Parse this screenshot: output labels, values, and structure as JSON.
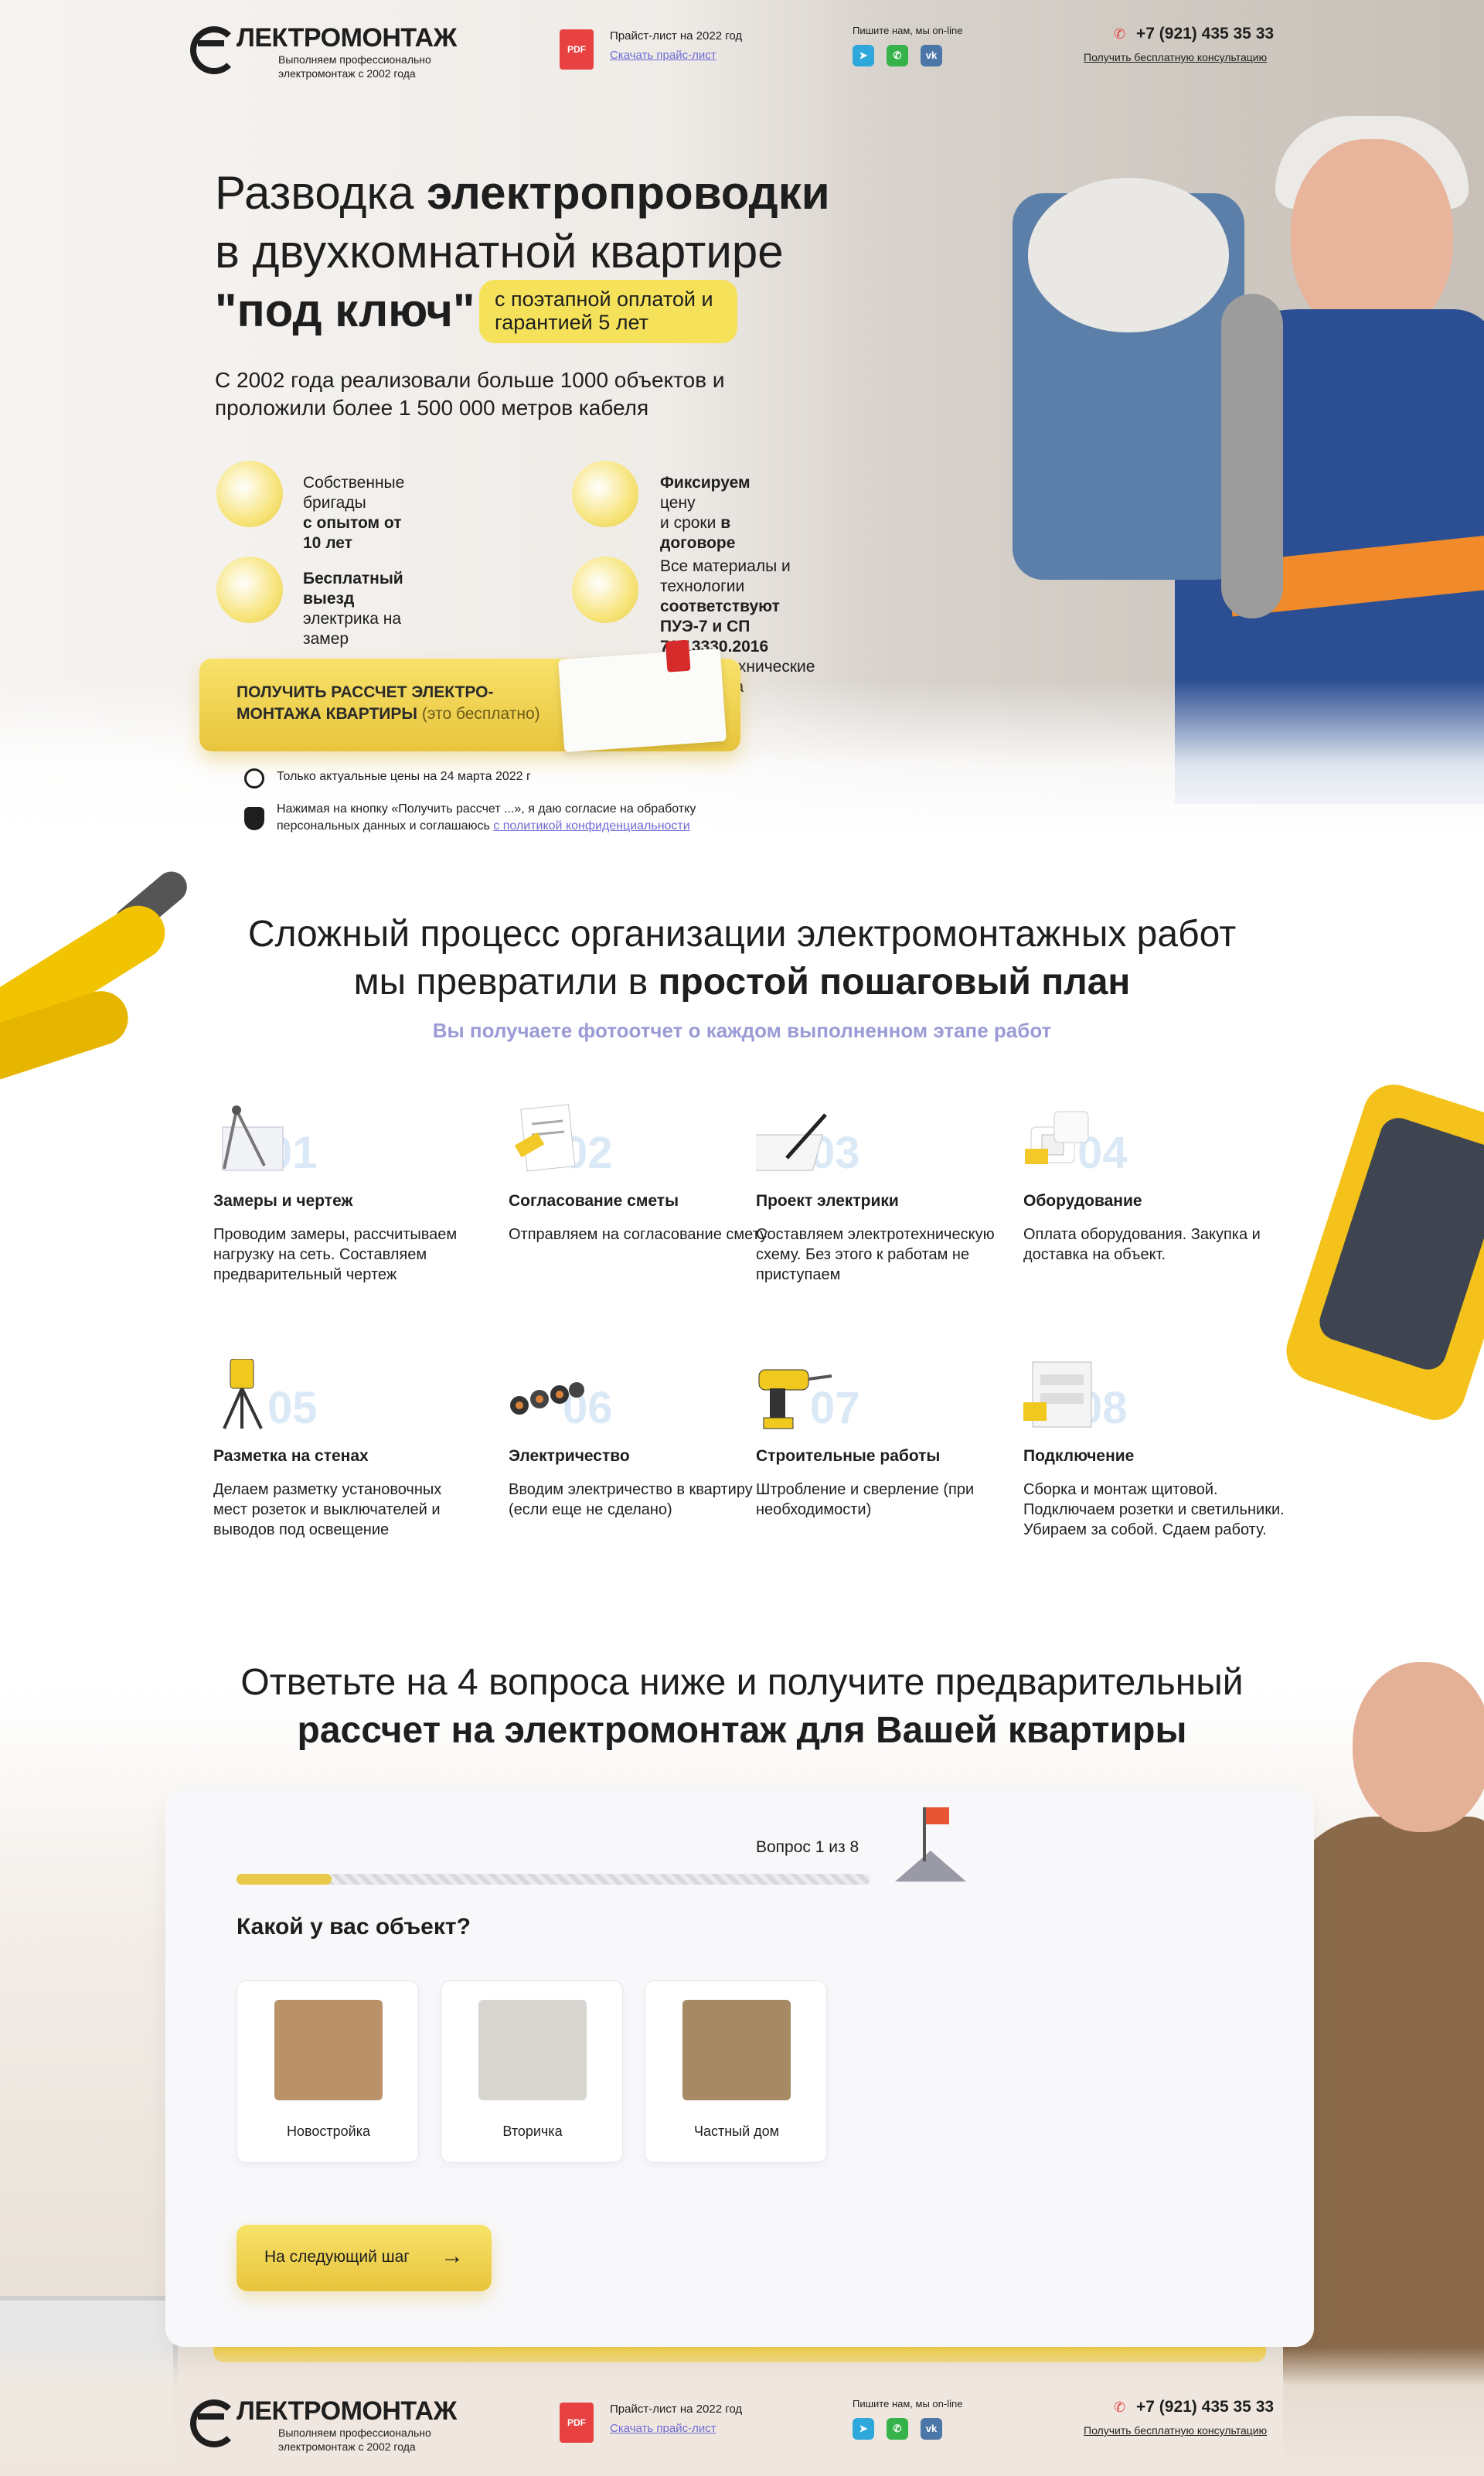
{
  "header": {
    "logo_word": "ЛЕКТРОМОНТАЖ",
    "logo_sub": "Выполняем профессионально электромонтаж с 2002 года",
    "pdf_badge": "PDF",
    "price_title": "Прайст-лист на 2022 год",
    "price_link": "Скачать прайс-лист",
    "write": "Пишите нам, мы on-line",
    "socials": [
      "tg",
      "wa",
      "vk"
    ],
    "phone": "+7 (921) 435 35 33",
    "consult": "Получить бесплатную консультацию"
  },
  "hero": {
    "title_l1_a": "Разводка ",
    "title_l1_b": "электропроводки",
    "title_l2": "в двухкомнатной квартире",
    "title_l3": "\"под ключ\"",
    "badge": "с поэтапной оплатой и гарантией 5 лет",
    "subtitle": "С 2002 года реализовали больше 1000 объектов и проложили более 1 500 000 метров кабеля",
    "features": [
      {
        "a": "Собственные бригады",
        "b": "с опытом от 10 лет",
        "icon": "helmet-icon"
      },
      {
        "a": "Фиксируем",
        "a2": " цену",
        "b": "и сроки ",
        "b2": "в договоре",
        "icon": "contract-icon"
      },
      {
        "a": "Бесплатный выезд",
        "b": "электрика на замер",
        "icon": "van-icon"
      },
      {
        "a": "Все материалы и технологии",
        "b": "соответствуют ПУЭ-7 и СП 76.13330.2016",
        "c": "Электротехнические устройства",
        "icon": "documents-icon"
      }
    ],
    "cta_line1": "ПОЛУЧИТЬ РАССЧЕТ ЭЛЕКТРО-",
    "cta_line2": "МОНТАЖА КВАРТИРЫ",
    "cta_free": "(это бесплатно)",
    "note1": "Только актуальные цены на 24 марта 2022 г",
    "note2": "Нажимая на кнопку «Получить рассчет ...», я даю согласие на обработку персональных данных и соглашаюсь ",
    "note2_link": "с политикой конфиденциальности"
  },
  "steps_section": {
    "title_l1": "Сложный процесс организации электромонтажных работ",
    "title_l2a": "мы превратили в ",
    "title_l2b": "простой пошаговый план",
    "subtitle": "Вы получаете фотоотчет о каждом выполненном этапе работ",
    "steps": [
      {
        "num": "01",
        "title": "Замеры и чертеж",
        "desc": "Проводим замеры, рассчитываем нагрузку на сеть. Составляем предварительный чертеж",
        "icon": "drafting-compass-icon"
      },
      {
        "num": "02",
        "title": "Согласование сметы",
        "desc": "Отправляем на согласование смету",
        "icon": "estimate-sheet-icon"
      },
      {
        "num": "03",
        "title": "Проект электрики",
        "desc": "Составляем электротехническую схему. Без этого к работам не приступаем",
        "icon": "blueprint-pen-icon"
      },
      {
        "num": "04",
        "title": "Оборудование",
        "desc": "Оплата оборудования. Закупка и доставка на объект.",
        "icon": "switch-socket-icon"
      },
      {
        "num": "05",
        "title": "Разметка на стенах",
        "desc": "Делаем разметку установочных мест розеток и выключателей и выводов под освещение",
        "icon": "laser-level-icon"
      },
      {
        "num": "06",
        "title": "Электричество",
        "desc": "Вводим электричество в квартиру (если еще не сделано)",
        "icon": "cables-icon"
      },
      {
        "num": "07",
        "title": "Строительные работы",
        "desc": "Штробление и сверление (при необходимости)",
        "icon": "drill-icon"
      },
      {
        "num": "08",
        "title": "Подключение",
        "desc": "Сборка и монтаж щитовой. Подключаем розетки и светильники. Убираем за собой. Сдаем работу.",
        "icon": "switchboard-icon"
      }
    ]
  },
  "quiz_section": {
    "title_l1": "Ответьте на 4 вопроса ниже и получите предварительный",
    "title_l2": "рассчет на электромонтаж для Вашей квартиры",
    "counter": "Вопрос 1 из 8",
    "progress": 0.125,
    "question": "Какой у вас объект?",
    "options": [
      {
        "label": "Новостройка",
        "img": "new-building-floorplan-icon",
        "color": "#b9926a"
      },
      {
        "label": "Вторичка",
        "img": "apartment-3d-plan-icon",
        "color": "#d9d6d2"
      },
      {
        "label": "Частный дом",
        "img": "house-floorplan-icon",
        "color": "#a68a64"
      }
    ],
    "next_label": "На следующий шаг",
    "next_arrow": "→"
  },
  "colors": {
    "accent": "#f0d552",
    "link": "#6f6bd6",
    "subtitle": "#9b9bd6",
    "pdf": "#e84141"
  }
}
